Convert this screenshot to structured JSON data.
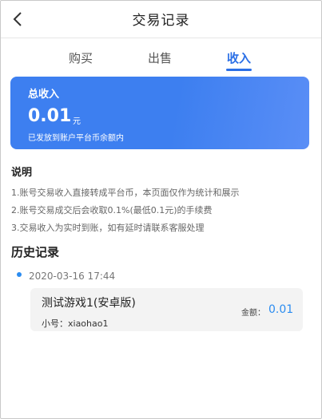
{
  "header": {
    "title": "交易记录"
  },
  "tabs": [
    {
      "label": "购买",
      "active": false
    },
    {
      "label": "出售",
      "active": false
    },
    {
      "label": "收入",
      "active": true
    }
  ],
  "income": {
    "label": "总收入",
    "amount": "0.01",
    "unit": "元",
    "note": "已发放到账户平台币余额内"
  },
  "explain": {
    "title": "说明",
    "lines": [
      "1.账号交易收入直接转成平台币，本页面仅作为统计和展示",
      "2.账号交易成交后会收取0.1%(最低0.1元)的手续费",
      "3.交易收入为实时到账，如有延时请联系客服处理"
    ]
  },
  "history": {
    "title": "历史记录",
    "records": [
      {
        "date": "2020-03-16 17:44",
        "game": "测试游戏1(安卓版)",
        "sub_account": "小号：xiaohao1",
        "amount_label": "金额：",
        "amount": "0.01"
      }
    ]
  },
  "colors": {
    "accent": "#2b6fe6",
    "card": "#3d7ff0",
    "amount": "#2b8cf0"
  }
}
